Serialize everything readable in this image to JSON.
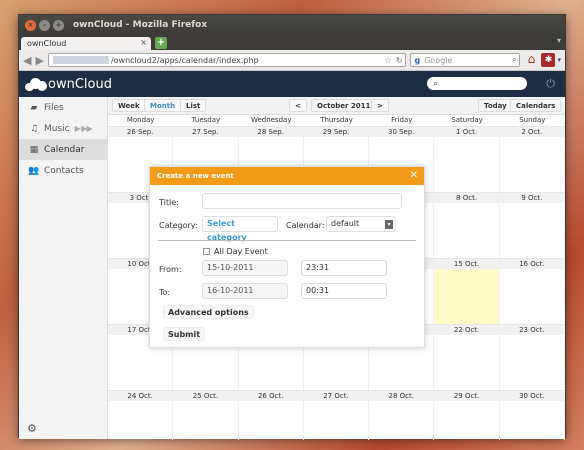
{
  "browser": {
    "window_title": "ownCloud - Mozilla Firefox",
    "tab_title": "ownCloud",
    "url": "/owncloud2/apps/calendar/index.php",
    "search_placeholder": "Google"
  },
  "owncloud": {
    "logo_text": "ownCloud",
    "search_value": "",
    "sidebar": {
      "items": [
        {
          "label": "Files",
          "icon": "folder-icon"
        },
        {
          "label": "Music",
          "icon": "music-icon"
        },
        {
          "label": "Calendar",
          "icon": "calendar-icon",
          "active": true
        },
        {
          "label": "Contacts",
          "icon": "contacts-icon"
        }
      ]
    },
    "toolbar": {
      "week": "Week",
      "month": "Month",
      "list": "List",
      "prev": "<",
      "current": "October 2011",
      "next": ">",
      "today": "Today",
      "calendars": "Calendars"
    },
    "weekdays": [
      "Monday",
      "Tuesday",
      "Wednesday",
      "Thursday",
      "Friday",
      "Saturday",
      "Sunday"
    ],
    "weeks": [
      [
        "26 Sep.",
        "27 Sep.",
        "28 Sep.",
        "29 Sep.",
        "30 Sep.",
        "1 Oct.",
        "2 Oct."
      ],
      [
        "3 Oct.",
        "",
        "",
        "",
        "",
        "8 Oct.",
        "9 Oct."
      ],
      [
        "10 Oct.",
        "",
        "",
        "",
        "",
        "15 Oct.",
        "16 Oct."
      ],
      [
        "17 Oct.",
        "",
        "",
        "",
        "",
        "22 Oct.",
        "23 Oct."
      ],
      [
        "24 Oct.",
        "25 Oct.",
        "26 Oct.",
        "27 Oct.",
        "28 Oct.",
        "29 Oct.",
        "30 Oct."
      ]
    ],
    "dialog": {
      "title": "Create a new event",
      "title_label": "Title:",
      "title_value": "",
      "category_label": "Category:",
      "category_button": "Select category",
      "calendar_label": "Calendar:",
      "calendar_value": "default",
      "all_day": "All Day Event",
      "from_label": "From:",
      "from_date": "15-10-2011",
      "from_time": "23:31",
      "to_label": "To:",
      "to_date": "16-10-2011",
      "to_time": "00:31",
      "advanced": "Advanced options",
      "submit": "Submit"
    }
  },
  "colors": {
    "header_bg": "#1d2d44",
    "dialog_title_bg": "#f29b1a",
    "today_bg": "#fffbc8",
    "accent_blue": "#3a8cc8"
  }
}
